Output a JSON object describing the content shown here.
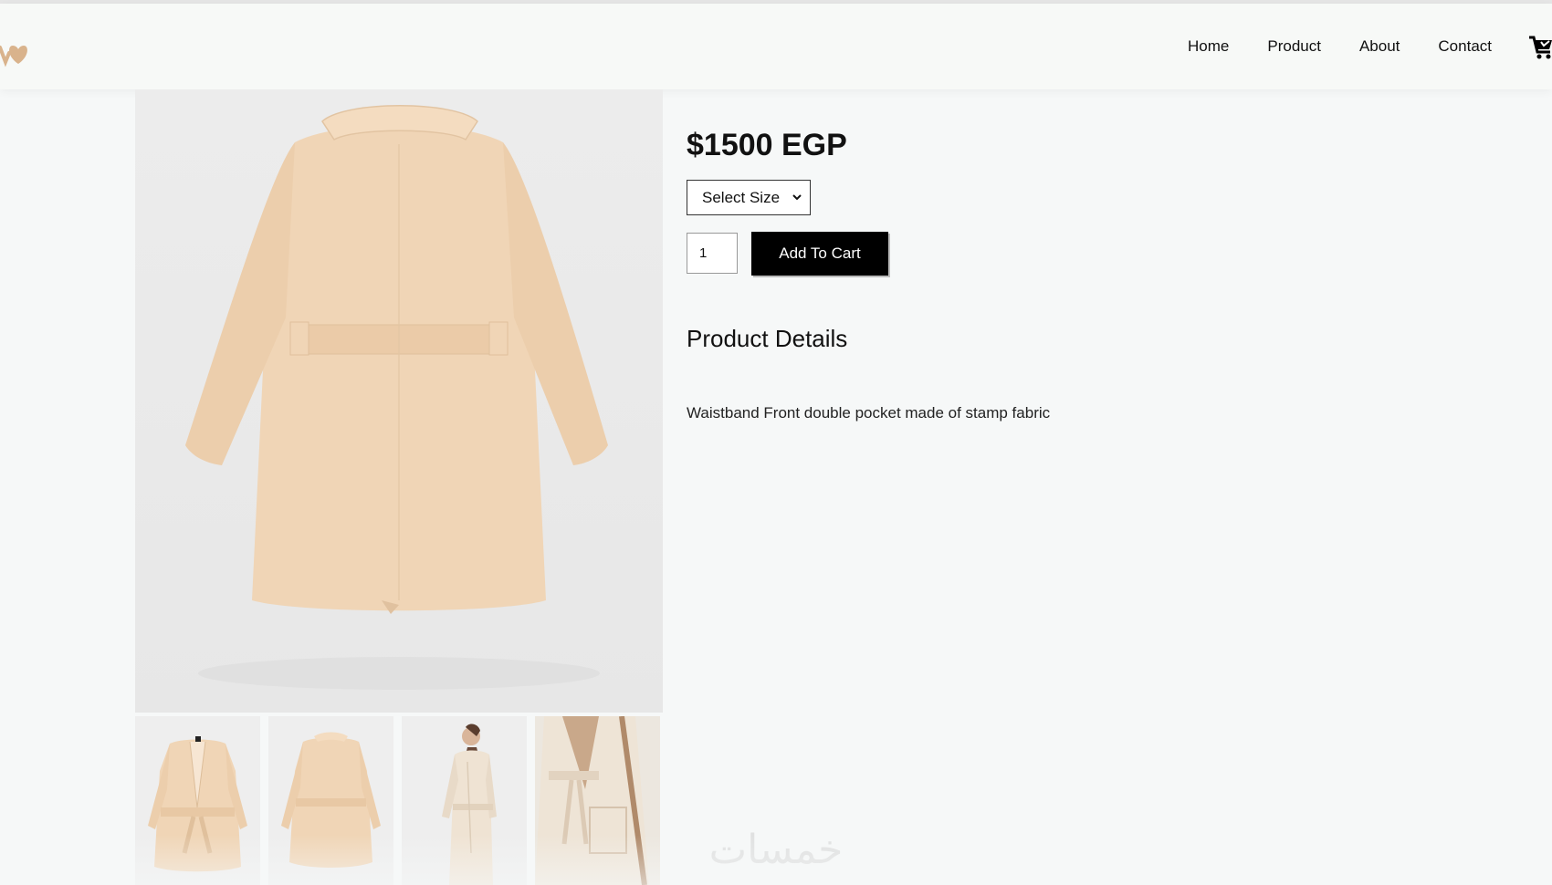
{
  "nav": {
    "links": [
      "Home",
      "Product",
      "About",
      "Contact"
    ]
  },
  "icons": {
    "logo": "heart-logo-icon",
    "cart": "cart-icon",
    "select": "chevron-down-icon"
  },
  "product": {
    "price": "$1500 EGP",
    "size_select": "Select Size",
    "quantity": "1",
    "add_to_cart": "Add To Cart",
    "details_title": "Product Details",
    "description": "Waistband Front double pocket made of stamp fabric"
  },
  "colors": {
    "coat": "#f0d5b6",
    "accent": "#000000",
    "logo": "#d9b38c"
  },
  "watermark": "خمسات"
}
